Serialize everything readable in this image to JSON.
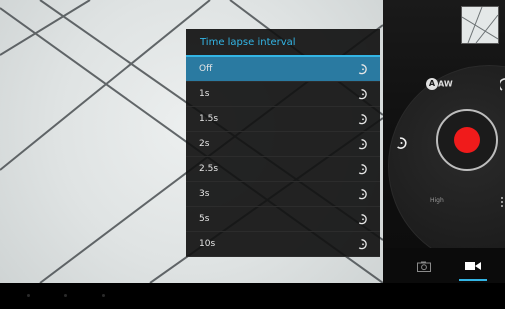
{
  "popup": {
    "title": "Time lapse interval",
    "selected_index": 0,
    "items": [
      {
        "label": "Off",
        "icon": "timelapse-off-icon"
      },
      {
        "label": "1s",
        "icon": "timelapse-1s-icon"
      },
      {
        "label": "1.5s",
        "icon": "timelapse-1.5s-icon"
      },
      {
        "label": "2s",
        "icon": "timelapse-2s-icon"
      },
      {
        "label": "2.5s",
        "icon": "timelapse-2.5s-icon"
      },
      {
        "label": "3s",
        "icon": "timelapse-3s-icon"
      },
      {
        "label": "5s",
        "icon": "timelapse-5s-icon"
      },
      {
        "label": "10s",
        "icon": "timelapse-10s-icon"
      }
    ]
  },
  "controls": {
    "white_balance_label": "AW",
    "quality_label": "High",
    "shutter_color": "#f01b1b",
    "accent_color": "#33b5e5"
  },
  "modes": [
    {
      "name": "camera",
      "icon": "camera-icon",
      "active": false
    },
    {
      "name": "video",
      "icon": "video-camera-icon",
      "active": true
    }
  ]
}
